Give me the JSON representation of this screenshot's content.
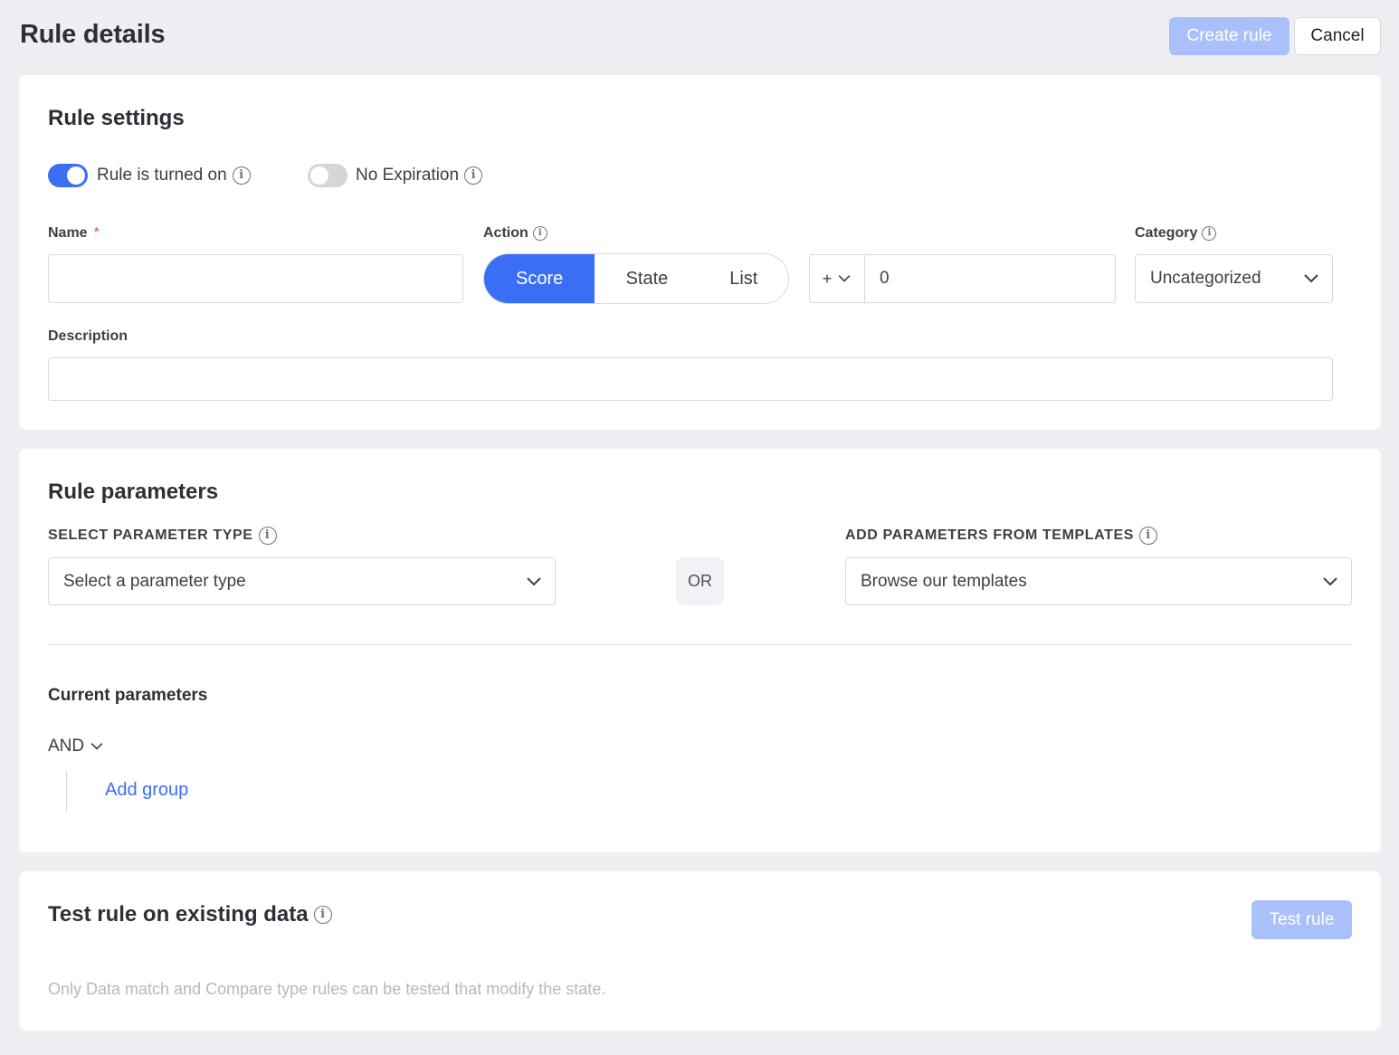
{
  "header": {
    "title": "Rule details",
    "create_label": "Create rule",
    "cancel_label": "Cancel"
  },
  "settings": {
    "title": "Rule settings",
    "toggle_on_label": "Rule is turned on",
    "toggle_on_state": true,
    "no_expiration_label": "No Expiration",
    "no_expiration_state": false,
    "name_label": "Name",
    "name_required": "*",
    "name_value": "",
    "action_label": "Action",
    "action_options": [
      "Score",
      "State",
      "List"
    ],
    "action_selected": "Score",
    "sign_value": "+",
    "score_value": "0",
    "category_label": "Category",
    "category_value": "Uncategorized",
    "description_label": "Description",
    "description_value": ""
  },
  "parameters": {
    "title": "Rule parameters",
    "select_type_label": "SELECT PARAMETER TYPE",
    "select_type_placeholder": "Select a parameter type",
    "or_label": "OR",
    "templates_label": "ADD PARAMETERS FROM TEMPLATES",
    "templates_placeholder": "Browse our templates",
    "current_label": "Current parameters",
    "logic_value": "AND",
    "add_group_label": "Add group"
  },
  "test": {
    "title": "Test rule on existing data",
    "button_label": "Test rule",
    "note": "Only Data match and Compare type rules can be tested that modify the state."
  },
  "colors": {
    "accent": "#3a6ef5",
    "accent_disabled": "#a9c0fb",
    "background": "#eeeff3"
  }
}
